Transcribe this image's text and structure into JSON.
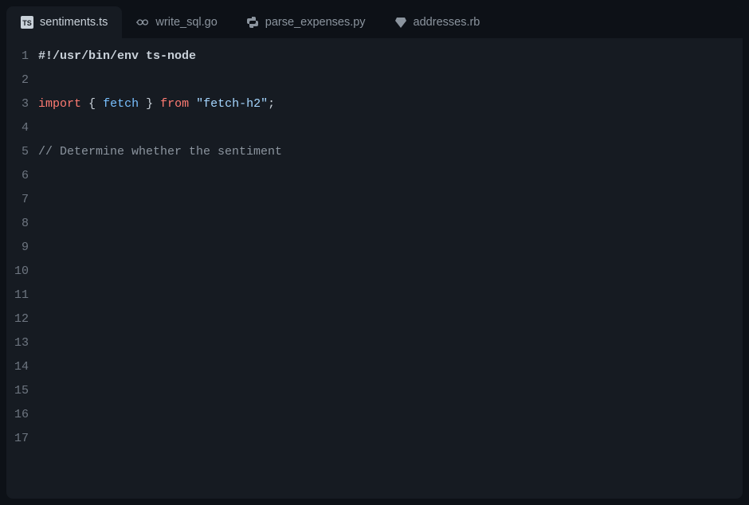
{
  "tabs": [
    {
      "label": "sentiments.ts",
      "icon": "ts",
      "active": true
    },
    {
      "label": "write_sql.go",
      "icon": "go",
      "active": false
    },
    {
      "label": "parse_expenses.py",
      "icon": "python",
      "active": false
    },
    {
      "label": "addresses.rb",
      "icon": "ruby",
      "active": false
    }
  ],
  "code": {
    "line_count": 17,
    "line1": {
      "shebang": "#!/usr/bin/env ts-node"
    },
    "line3": {
      "kw_import": "import",
      "brace_open": "{",
      "ident": "fetch",
      "brace_close": "}",
      "kw_from": "from",
      "string": "\"fetch-h2\"",
      "semi": ";"
    },
    "line5": {
      "comment": "// Determine whether the sentiment"
    }
  }
}
